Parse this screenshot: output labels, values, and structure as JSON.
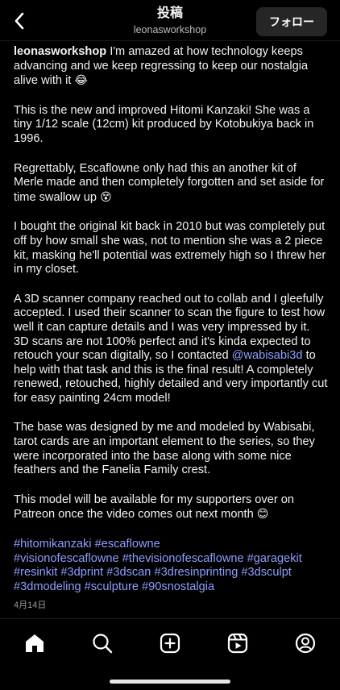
{
  "header": {
    "title": "投稿",
    "subtitle": "leonasworkshop",
    "follow_label": "フォロー",
    "back_icon": "chevron-left-icon"
  },
  "caption": {
    "username": "leonasworkshop",
    "intro_text": " I'm amazed at how technology keeps advancing and we keep regressing to keep our nostalgia alive with it ",
    "intro_emoji": "😂",
    "p1": "This is the new and improved Hitomi Kanzaki! She was a tiny 1/12 scale (12cm) kit produced by Kotobukiya back in 1996.",
    "p2_text": "Regrettably, Escaflowne only had this an another kit of Merle made and then completely forgotten and set aside for time swallow up ",
    "p2_emoji": "😵",
    "p3": "I bought the original kit back in 2010 but was completely put off by how small she was, not to mention she was a 2 piece kit, masking he'll potential was extremely high so I threw her in my closet.",
    "p4": "A 3D scanner company reached out to collab and I gleefully accepted. I used their scanner to scan the figure to test how well it can capture details and I was very impressed by it.",
    "p5_before": "3D scans are not 100% perfect and it's kinda expected to retouch your scan digitally, so I contacted ",
    "p5_mention": "@wabisabi3d",
    "p5_after": " to help with that task and this is the final result! A completely renewed, retouched, highly detailed and very importantly cut for easy painting 24cm model!",
    "p6": "The base was designed by me and modeled by Wabisabi, tarot cards are an important element to the series, so they were incorporated into the base along with some nice feathers and the Fanelia Family crest.",
    "p7_text": "This model will be available for my supporters over on Patreon once the video comes out next month ",
    "p7_emoji": "😊",
    "hashtags": [
      "#hitomikanzaki",
      "#escaflowne",
      "#visionofescaflowne",
      "#thevisionofescaflowne",
      "#garagekit",
      "#resinkit",
      "#3dprint",
      "#3dscan",
      "#3dresinprinting",
      "#3dsculpt",
      "#3dmodeling",
      "#sculpture",
      "#90snostalgia"
    ],
    "date": "4月14日"
  },
  "nav": {
    "icons": [
      "home-icon",
      "search-icon",
      "create-icon",
      "reels-icon",
      "profile-icon"
    ]
  },
  "colors": {
    "background": "#000000",
    "link": "#8e9eff",
    "follow_button": "#262626"
  }
}
